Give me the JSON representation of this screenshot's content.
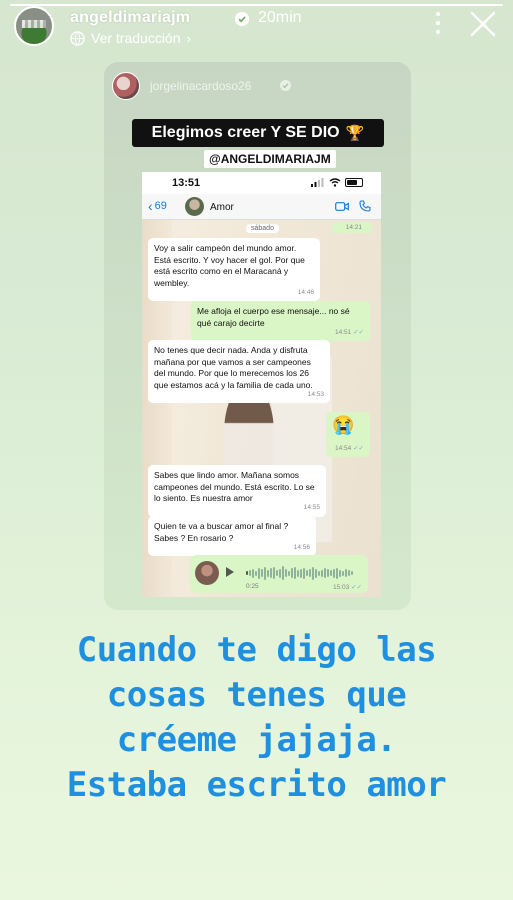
{
  "story": {
    "progress": 1.0,
    "username": "angeldimariajm",
    "time": "20min",
    "translate_label": "Ver traducción",
    "caption_lines": [
      "Cuando te digo las",
      "cosas tenes que",
      "créeme jajaja.",
      "Estaba escrito amor"
    ]
  },
  "repost": {
    "username": "jorgelinacardoso26",
    "banner_text": "Elegimos creer Y SE DIO",
    "banner_emoji": "🏆",
    "mention": "@ANGELDIMARIAJM"
  },
  "phone": {
    "clock": "13:51",
    "back_count": "69",
    "contact_name": "Amor",
    "day_chip": "sábado",
    "top_timestamp": "14:21",
    "messages": [
      {
        "dir": "in",
        "text": "Voy a salir campeón del mundo amor. Está escrito. Y voy hacer el gol. Por que está escrito como en el Maracaná y wembley.",
        "time": "14:46"
      },
      {
        "dir": "out",
        "text": "Me afloja el cuerpo ese mensaje... no sé qué carajo decirte",
        "time": "14:51"
      },
      {
        "dir": "in",
        "text": "No tenes que decir nada. Anda y disfruta mañana por que vamos a ser campeones del mundo. Por que lo merecemos los 26 que estamos acá y la familia de cada uno.",
        "time": "14:53"
      },
      {
        "dir": "out",
        "text": "😭",
        "time": "14:54"
      },
      {
        "dir": "in",
        "text": "Sabes que lindo amor. Mañana somos campeones del mundo. Está escrito. Lo se lo siento.  Es nuestra amor",
        "time": "14:55"
      },
      {
        "dir": "in",
        "text": "Quien te va a buscar amor al final ? Sabes ? En rosario ?",
        "time": "14:56"
      }
    ],
    "voice_note": {
      "duration": "0:25",
      "time": "15:03"
    }
  },
  "colors": {
    "caption": "#1f8fe0",
    "bubble_out": "#dbf6c6",
    "link_blue": "#1a7ad6"
  },
  "icons": [
    "verified-icon",
    "globe-icon",
    "more-icon",
    "close-icon",
    "trophy-icon",
    "signal-icon",
    "wifi-icon",
    "battery-icon",
    "back-chevron-icon",
    "video-call-icon",
    "phone-call-icon",
    "play-icon"
  ]
}
